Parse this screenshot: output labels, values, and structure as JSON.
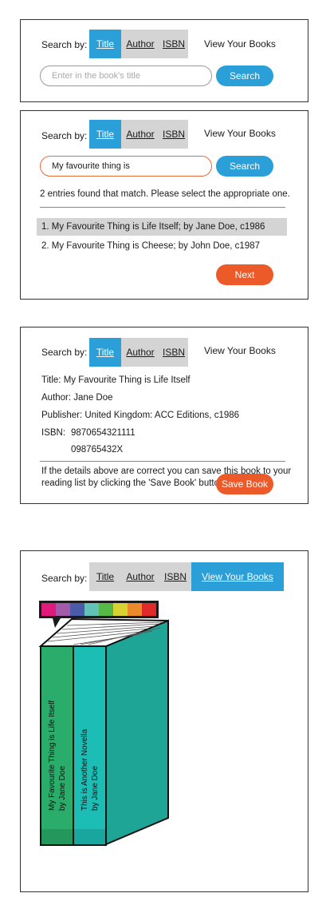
{
  "search_label": "Search by:",
  "tabs": {
    "title": "Title",
    "author": "Author",
    "isbn": "ISBN"
  },
  "view_books": "View Your Books",
  "panel1": {
    "placeholder": "Enter in the book's title",
    "search_button": "Search"
  },
  "panel2": {
    "query": "My favourite thing is",
    "search_button": "Search",
    "message": "2 entries found that match. Please select the appropriate one.",
    "results": [
      "1.  My Favourite Thing is Life Itself;  by Jane Doe, c1986",
      "2.  My Favourite Thing is Cheese;  by John Doe, c1987"
    ],
    "next_button": "Next"
  },
  "panel3": {
    "title_line": "Title:  My Favourite Thing is Life Itself",
    "author_line": "Author:  Jane Doe",
    "publisher_line": "Publisher:  United Kingdom: ACC Editions, c1986",
    "isbn_label": "ISBN:",
    "isbn_1": "9870654321111",
    "isbn_2": "098765432X",
    "note_line1": "If the details above are correct you can save this book to your",
    "note_line2": "reading list by clicking the 'Save Book' button.",
    "save_button": "Save Book"
  },
  "panel4": {
    "palette": [
      "#e0197d",
      "#a35aa8",
      "#4a5ba8",
      "#62c2b8",
      "#56b847",
      "#d8d233",
      "#ec8a2b",
      "#e02a2a"
    ],
    "book1_line1": "My Favourite Thing is Life Itself",
    "book1_line2": "by Jane Doe",
    "book2_line1": "This is Another Novella",
    "book2_line2": "by Jane Doe",
    "book1_color": "#2aac6a",
    "book2_color": "#1cbdb5",
    "block_color": "#1ea596"
  }
}
